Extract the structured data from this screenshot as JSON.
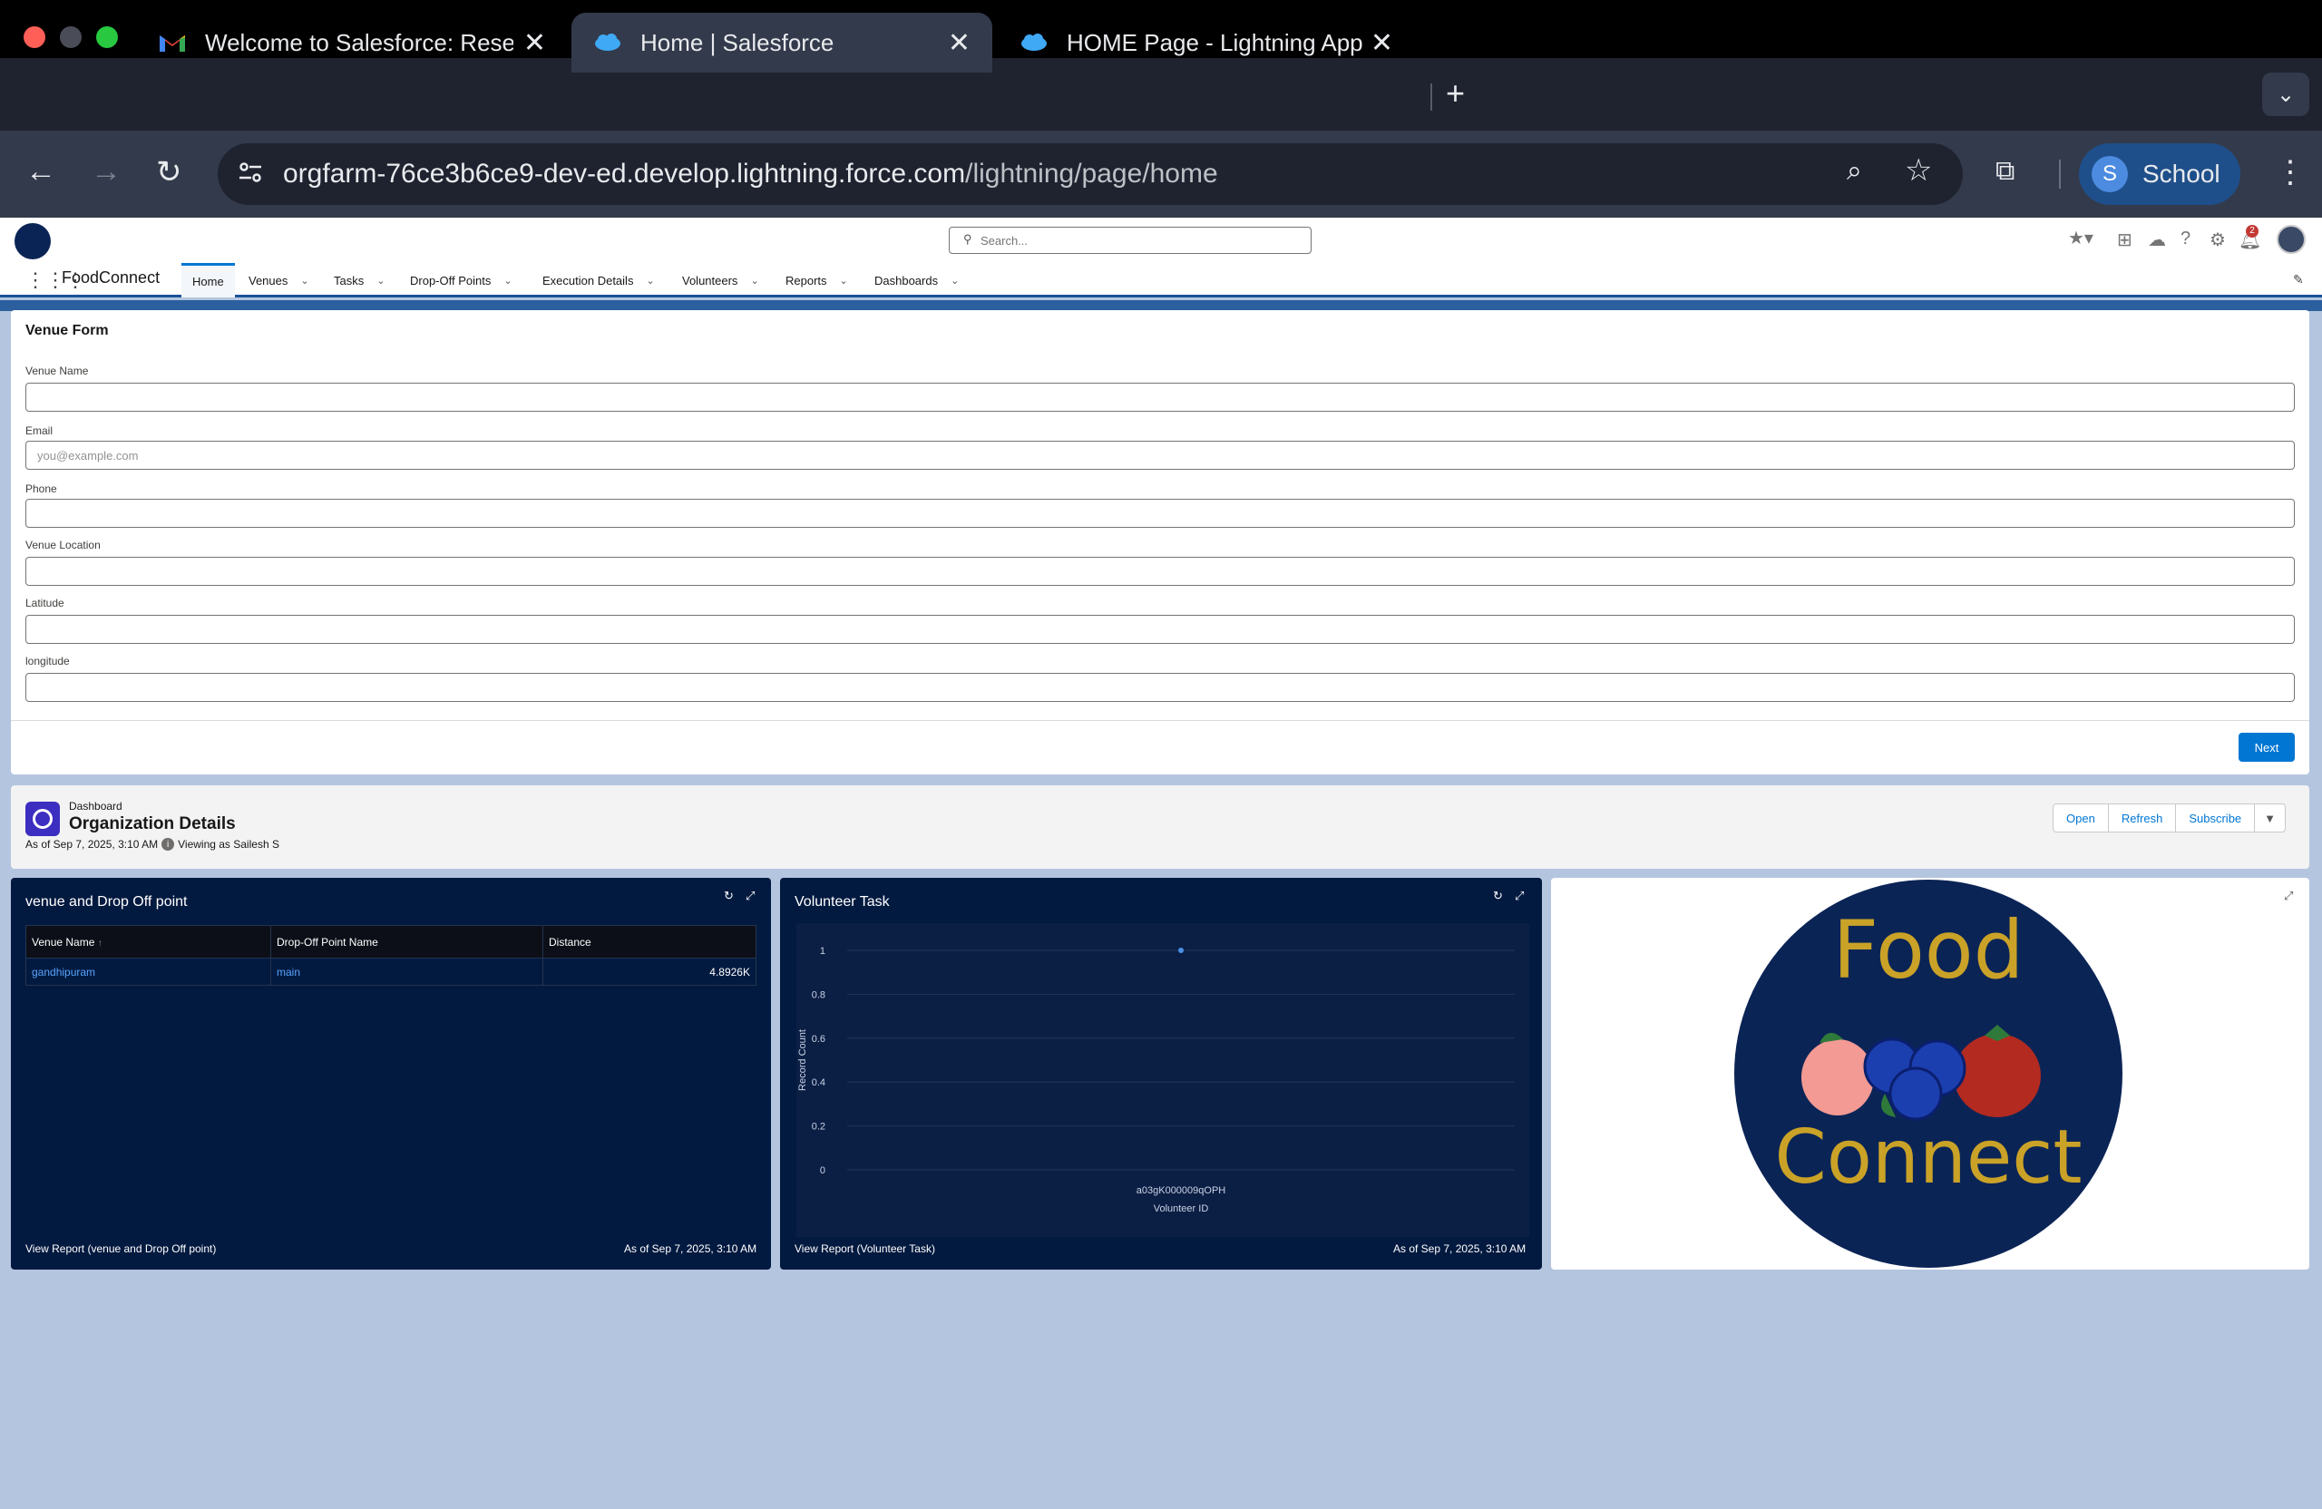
{
  "browser": {
    "tabs": [
      {
        "title": "Welcome to Salesforce: Reset",
        "icon": "gmail-icon",
        "active": false
      },
      {
        "title": "Home | Salesforce",
        "icon": "salesforce-cloud-icon",
        "active": true
      },
      {
        "title": "HOME Page - Lightning App B",
        "icon": "salesforce-cloud-icon",
        "active": false
      }
    ],
    "url_domain": "orgfarm-76ce3b6ce9-dev-ed.develop.lightning.force.com",
    "url_path": "/lightning/page/home",
    "profile_initial": "S",
    "profile_name": "School"
  },
  "sf_header": {
    "search_placeholder": "Search...",
    "notification_count": "2"
  },
  "nav": {
    "app_name": "FoodConnect",
    "items": [
      {
        "label": "Home",
        "active": true,
        "dropdown": false
      },
      {
        "label": "Venues",
        "dropdown": true
      },
      {
        "label": "Tasks",
        "dropdown": true
      },
      {
        "label": "Drop-Off Points",
        "dropdown": true
      },
      {
        "label": "Execution Details",
        "dropdown": true
      },
      {
        "label": "Volunteers",
        "dropdown": true
      },
      {
        "label": "Reports",
        "dropdown": true
      },
      {
        "label": "Dashboards",
        "dropdown": true
      }
    ]
  },
  "venue_form": {
    "title": "Venue Form",
    "fields": [
      {
        "label": "Venue Name",
        "value": "",
        "placeholder": ""
      },
      {
        "label": "Email",
        "value": "",
        "placeholder": "you@example.com"
      },
      {
        "label": "Phone",
        "value": "",
        "placeholder": ""
      },
      {
        "label": "Venue Location",
        "value": "",
        "placeholder": ""
      },
      {
        "label": "Latitude",
        "value": "",
        "placeholder": ""
      },
      {
        "label": "longitude",
        "value": "",
        "placeholder": ""
      }
    ],
    "next_label": "Next"
  },
  "dashboard": {
    "kicker": "Dashboard",
    "title": "Organization Details",
    "as_of": "As of Sep 7, 2025, 3:10 AM",
    "viewing_as": "Viewing as Sailesh S",
    "buttons": {
      "open": "Open",
      "refresh": "Refresh",
      "subscribe": "Subscribe"
    }
  },
  "widget_table": {
    "title": "venue and Drop Off point",
    "columns": [
      "Venue Name",
      "Drop-Off Point Name",
      "Distance"
    ],
    "sort_indicator": "↑",
    "rows": [
      {
        "venue": "gandhipuram",
        "dropoff": "main",
        "distance": "4.8926K"
      }
    ],
    "footer_link": "View Report (venue and Drop Off point)",
    "footer_time": "As of Sep 7, 2025, 3:10 AM"
  },
  "widget_chart": {
    "title": "Volunteer Task",
    "footer_link": "View Report (Volunteer Task)",
    "footer_time": "As of Sep 7, 2025, 3:10 AM"
  },
  "chart_data": {
    "type": "scatter",
    "title": "Volunteer Task",
    "xlabel": "Volunteer ID",
    "ylabel": "Record Count",
    "categories": [
      "a03gK000009qOPH"
    ],
    "values": [
      1
    ],
    "ylim": [
      0,
      1
    ],
    "yticks": [
      "1",
      "0.8",
      "0.6",
      "0.4",
      "0.2",
      "0"
    ],
    "grid": true
  },
  "logo": {
    "line1": "Food",
    "line2": "Connect"
  },
  "colors": {
    "brand_blue": "#0176d3",
    "widget_bg": "#031a40",
    "logo_bg": "#0b2456",
    "logo_gold": "#c9a227"
  }
}
